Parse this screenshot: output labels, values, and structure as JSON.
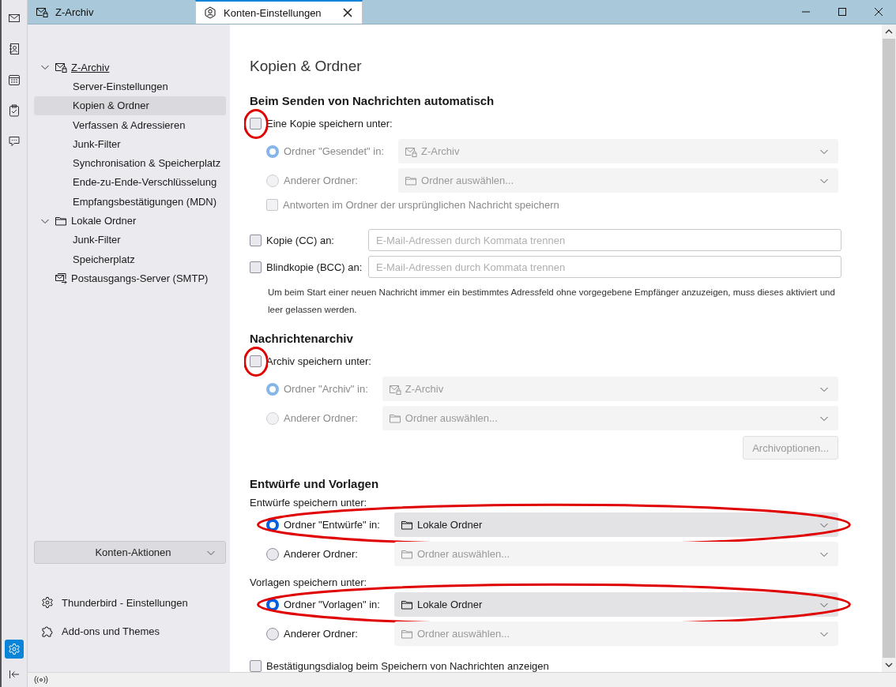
{
  "spaces": [
    {
      "kind": "mail",
      "selected": false
    },
    {
      "kind": "address-book",
      "selected": false
    },
    {
      "kind": "calendar",
      "selected": false
    },
    {
      "kind": "tasks",
      "selected": false
    },
    {
      "kind": "chat",
      "selected": false
    }
  ],
  "spaces_footer": [
    {
      "kind": "settings",
      "selected": true
    },
    {
      "kind": "collapse",
      "selected": false
    }
  ],
  "tabs": [
    {
      "label": "Z-Archiv",
      "selected": false,
      "closable": false
    },
    {
      "label": "Konten-Einstellungen",
      "selected": true,
      "closable": true
    }
  ],
  "sidebar": {
    "tree": [
      {
        "label": "Z-Archiv",
        "kind": "mail-account",
        "expanded": true,
        "selected": false,
        "children": [
          {
            "label": "Server-Einstellungen",
            "selected": false
          },
          {
            "label": "Kopien & Ordner",
            "selected": true
          },
          {
            "label": "Verfassen & Adressieren",
            "selected": false
          },
          {
            "label": "Junk-Filter",
            "selected": false
          },
          {
            "label": "Synchronisation & Speicherplatz",
            "selected": false
          },
          {
            "label": "Ende-zu-Ende-Verschlüsselung",
            "selected": false
          },
          {
            "label": "Empfangsbestätigungen (MDN)",
            "selected": false
          }
        ]
      },
      {
        "label": "Lokale Ordner",
        "kind": "folder",
        "expanded": true,
        "selected": false,
        "children": [
          {
            "label": "Junk-Filter",
            "selected": false
          },
          {
            "label": "Speicherplatz",
            "selected": false
          }
        ]
      },
      {
        "label": "Postausgangs-Server (SMTP)",
        "kind": "outbox",
        "selected": false
      }
    ],
    "actions_button": "Konten-Aktionen",
    "links": [
      {
        "label": "Thunderbird - Einstellungen",
        "kind": "gear"
      },
      {
        "label": "Add-ons und Themes",
        "kind": "puzzle"
      }
    ]
  },
  "page": {
    "title": "Kopien & Ordner",
    "sections": [
      {
        "heading": "Beim Senden von Nachrichten automatisch",
        "items": [
          {
            "kind": "checkbox",
            "label": "Eine Kopie speichern unter:",
            "checked": false,
            "disabled": false,
            "highlighted": true,
            "children": [
              {
                "kind": "radio",
                "label": "Ordner \"Gesendet\" in:",
                "selected": true,
                "disabled": true,
                "highlighted": false,
                "select": {
                  "value": "Z-Archiv",
                  "kind": "mail-account",
                  "disabled": true
                }
              },
              {
                "kind": "radio",
                "label": "Anderer Ordner:",
                "selected": false,
                "disabled": true,
                "highlighted": false,
                "select": {
                  "value": "Ordner auswählen...",
                  "kind": "folder",
                  "disabled": true
                }
              },
              {
                "kind": "checkbox",
                "label": "Antworten im Ordner der ursprünglichen Nachricht speichern",
                "checked": false,
                "disabled": true,
                "highlighted": false
              }
            ]
          },
          {
            "kind": "address",
            "label": "Kopie (CC) an:",
            "checked": false,
            "placeholder": "E-Mail-Adressen durch Kommata trennen"
          },
          {
            "kind": "address",
            "label": "Blindkopie (BCC) an:",
            "checked": false,
            "placeholder": "E-Mail-Adressen durch Kommata trennen"
          },
          {
            "kind": "note",
            "text": "Um beim Start einer neuen Nachricht immer ein bestimmtes Adressfeld ohne vorgegebene Empfänger anzuzeigen, muss dieses aktiviert und leer gelassen werden."
          }
        ]
      },
      {
        "heading": "Nachrichtenarchiv",
        "items": [
          {
            "kind": "checkbox",
            "label": "Archiv speichern unter:",
            "checked": false,
            "disabled": false,
            "highlighted": true,
            "children": [
              {
                "kind": "radio",
                "label": "Ordner \"Archiv\" in:",
                "selected": true,
                "disabled": true,
                "highlighted": false,
                "select": {
                  "value": "Z-Archiv",
                  "kind": "mail-account",
                  "disabled": true
                }
              },
              {
                "kind": "radio",
                "label": "Anderer Ordner:",
                "selected": false,
                "disabled": true,
                "highlighted": false,
                "select": {
                  "value": "Ordner auswählen...",
                  "kind": "folder",
                  "disabled": true
                }
              }
            ]
          },
          {
            "kind": "button",
            "label": "Archivoptionen...",
            "disabled": true
          }
        ]
      },
      {
        "heading": "Entwürfe und Vorlagen",
        "items": [
          {
            "kind": "caption",
            "text": "Entwürfe speichern unter:",
            "children": [
              {
                "kind": "radio",
                "label": "Ordner \"Entwürfe\" in:",
                "selected": true,
                "disabled": false,
                "highlighted": true,
                "select": {
                  "value": "Lokale Ordner",
                  "kind": "folder",
                  "disabled": false
                }
              },
              {
                "kind": "radio",
                "label": "Anderer Ordner:",
                "selected": false,
                "disabled": false,
                "highlighted": false,
                "select": {
                  "value": "Ordner auswählen...",
                  "kind": "folder",
                  "disabled": true
                }
              }
            ]
          },
          {
            "kind": "caption",
            "text": "Vorlagen speichern unter:",
            "children": [
              {
                "kind": "radio",
                "label": "Ordner \"Vorlagen\" in:",
                "selected": true,
                "disabled": false,
                "highlighted": true,
                "select": {
                  "value": "Lokale Ordner",
                  "kind": "folder",
                  "disabled": false
                }
              },
              {
                "kind": "radio",
                "label": "Anderer Ordner:",
                "selected": false,
                "disabled": false,
                "highlighted": false,
                "select": {
                  "value": "Ordner auswählen...",
                  "kind": "folder",
                  "disabled": true
                }
              }
            ]
          },
          {
            "kind": "checkbox",
            "label": "Bestätigungsdialog beim Speichern von Nachrichten anzeigen",
            "checked": false,
            "disabled": false,
            "highlighted": false
          }
        ]
      }
    ]
  }
}
